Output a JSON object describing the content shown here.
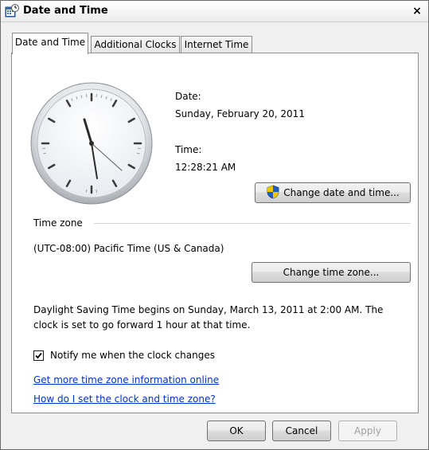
{
  "window": {
    "title": "Date and Time",
    "close_glyph": "×"
  },
  "tabs": [
    {
      "label": "Date and Time",
      "active": true
    },
    {
      "label": "Additional Clocks",
      "active": false
    },
    {
      "label": "Internet Time",
      "active": false
    }
  ],
  "datetime": {
    "date_label": "Date:",
    "date_value": "Sunday, February 20, 2011",
    "time_label": "Time:",
    "time_value": "12:28:21 AM",
    "change_button": "Change date and time..."
  },
  "timezone": {
    "section_label": "Time zone",
    "value": "(UTC-08:00) Pacific Time (US & Canada)",
    "change_button": "Change time zone..."
  },
  "dst": {
    "line1": "Daylight Saving Time begins on Sunday, March 13, 2011 at 2:00 AM. The",
    "line2": "clock is set to go forward 1 hour at that time."
  },
  "notify": {
    "label": "Notify me when the clock changes",
    "checked": true
  },
  "links": {
    "more_info": "Get more time zone information online",
    "how_to": "How do I set the clock and time zone?"
  },
  "footer": {
    "ok": "OK",
    "cancel": "Cancel",
    "apply": "Apply"
  },
  "icons": {
    "window": "datetime-app-icon",
    "uac": "uac-shield-icon",
    "close": "close-icon",
    "check": "checkmark-icon"
  },
  "colors": {
    "link": "#0033cc",
    "panel_border": "#8e8f8f",
    "window_bg": "#f0f0f0"
  }
}
